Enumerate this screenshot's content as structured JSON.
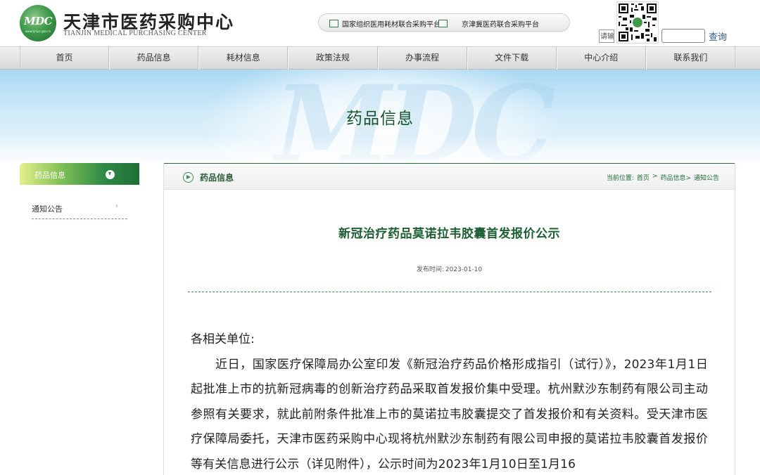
{
  "header": {
    "logo_mark": "MDC",
    "logo_url": "www.tjmpc.gov.cn",
    "logo_cn": "天津市医药采购中心",
    "logo_en": "TIANJIN MEDICAL PURCHASING CENTER",
    "platform_links": [
      "国家组织医用耗材联合采购平台",
      "京津冀医药联合采购平台"
    ],
    "search": {
      "prefix_text": "请输",
      "button_label": "查询"
    }
  },
  "nav": {
    "items": [
      "首页",
      "药品信息",
      "耗材信息",
      "政策法规",
      "办事流程",
      "文件下载",
      "中心介绍",
      "联系我们"
    ]
  },
  "banner": {
    "title": "药品信息",
    "watermark": "MDC"
  },
  "sidebar": {
    "head_label": "药品信息",
    "items": [
      {
        "label": "通知公告"
      }
    ]
  },
  "content": {
    "section_title": "药品信息",
    "breadcrumb": {
      "prefix": "当前位置:",
      "items": [
        "首页",
        ">",
        "药品信息>",
        "通知公告"
      ]
    },
    "article": {
      "title": "新冠治疗药品莫诺拉韦胶囊首发报价公示",
      "date_label": "发布时间:",
      "date": "2023-01-10",
      "salutation": "各相关单位:",
      "paragraph": "近日，国家医疗保障局办公室印发《新冠治疗药品价格形成指引（试行）》，2023年1月1日起批准上市的抗新冠病毒的创新治疗药品采取首发报价集中受理。杭州默沙东制药有限公司主动参照有关要求，就此前附条件批准上市的莫诺拉韦胶囊提交了首发报价和有关资料。受天津市医疗保障局委托，天津市医药采购中心现将杭州默沙东制药有限公司申报的莫诺拉韦胶囊首发报价等有关信息进行公示（详见附件），公示时间为2023年1月10日至1月16"
    }
  },
  "colors": {
    "brand_green": "#1f6e36",
    "title_green": "#1d5e33",
    "banner_blue": "#a9d8f3"
  },
  "icons": {
    "sidebar_head": "down-arrow-circle-icon",
    "panel_head": "play-circle-icon",
    "side_item": "chevron-right-icon",
    "platform": "checkbox-icon"
  }
}
